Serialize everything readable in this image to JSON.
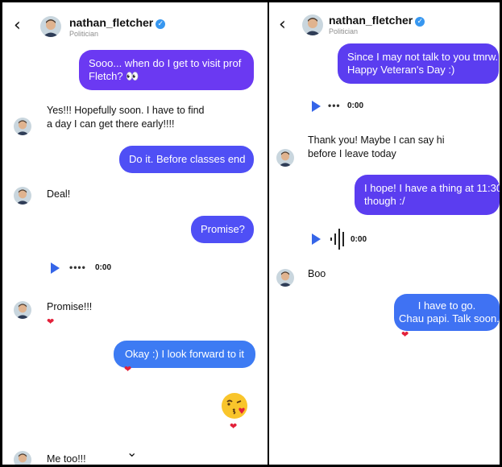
{
  "left": {
    "back_glyph": "‹",
    "header": {
      "username": "nathan_fletcher",
      "subtitle": "Politician"
    },
    "messages": {
      "m1": [
        "Sooo... when do I get to visit prof",
        "Fletch? 👀"
      ],
      "m2": [
        "Yes!!! Hopefully soon. I have to find",
        "a day I can get there early!!!!"
      ],
      "m3": "Do it. Before classes end",
      "m4": "Deal!",
      "m5": "Promise?",
      "m6_dots": "••••",
      "m6_time": "0:00",
      "m7": "Promise!!!",
      "m8": "Okay :) I look forward to it",
      "m10": "Me too!!!"
    },
    "heart_glyph": "❤",
    "chevron_glyph": "⌄"
  },
  "right": {
    "back_glyph": "‹",
    "header": {
      "username": "nathan_fletcher",
      "subtitle": "Politician"
    },
    "messages": {
      "r1": [
        "Since I may not talk to you tmrw.",
        "Happy Veteran's Day :)"
      ],
      "r2_dots": "•••",
      "r2_time": "0:00",
      "r3": [
        "Thank you! Maybe I can say hi",
        "before I leave today"
      ],
      "r4": [
        "I hope! I have a thing at 11:30",
        "though :/"
      ],
      "r5_time": "0:00",
      "r6": "Boo",
      "r7": [
        "I have to go.",
        "Chau papi. Talk soon."
      ]
    },
    "heart_glyph": "❤"
  },
  "colors": {
    "purple": "#6b39f2",
    "indigo": "#4f4ff5",
    "blue": "#3d7bf3",
    "verified": "#3797f0",
    "heart": "#e3213a",
    "play": "#3565e8"
  }
}
